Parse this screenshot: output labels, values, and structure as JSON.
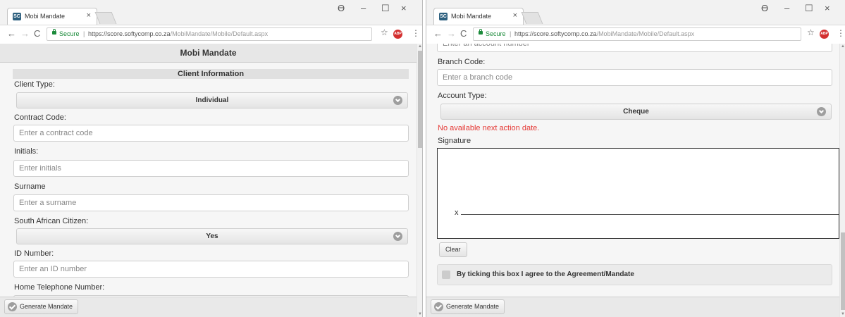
{
  "browser": {
    "tab_title": "Mobi Mandate",
    "tab_close": "×",
    "minimize": "–",
    "maximize": "☐",
    "close": "×",
    "secure_label": "Secure",
    "url_host": "https://score.softycomp.co.za",
    "url_path": "/MobiMandate/Mobile/Default.aspx",
    "favicon_text": "SC",
    "ext_text": "ABP"
  },
  "page": {
    "header": "Mobi Mandate",
    "footer_button": "Generate Mandate"
  },
  "left": {
    "section_title": "Client Information",
    "client_type": {
      "label": "Client Type:",
      "value": "Individual"
    },
    "contract_code": {
      "label": "Contract Code:",
      "placeholder": "Enter a contract code"
    },
    "initials": {
      "label": "Initials:",
      "placeholder": "Enter initials"
    },
    "surname": {
      "label": "Surname",
      "placeholder": "Enter a surname"
    },
    "citizen": {
      "label": "South African Citizen:",
      "value": "Yes"
    },
    "id_number": {
      "label": "ID Number:",
      "placeholder": "Enter an ID number"
    },
    "home_phone": {
      "label": "Home Telephone Number:"
    }
  },
  "right": {
    "account_number": {
      "placeholder": "Enter an account number"
    },
    "branch_code": {
      "label": "Branch Code:",
      "placeholder": "Enter a branch code"
    },
    "account_type": {
      "label": "Account Type:",
      "value": "Cheque"
    },
    "error": "No available next action date.",
    "signature_label": "Signature",
    "signature_x": "x",
    "clear_button": "Clear",
    "agree_text": "By ticking this box I agree to the Agreement/Mandate"
  },
  "colors": {
    "error": "#e53935",
    "secure": "#1b8a3a"
  }
}
